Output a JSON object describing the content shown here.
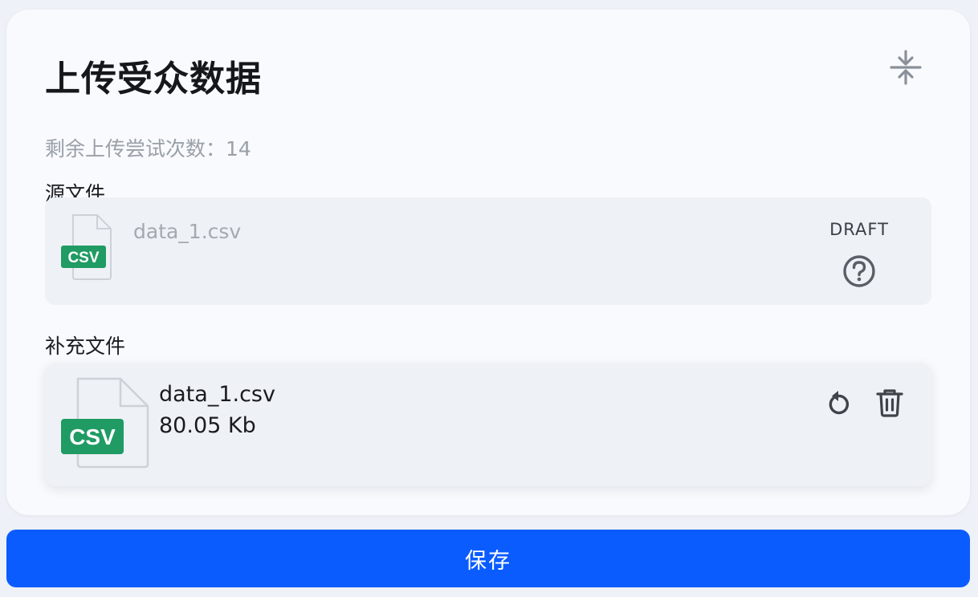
{
  "panel": {
    "title": "上传受众数据",
    "attempts_text": "剩余上传尝试次数：14",
    "collapse_icon": "collapse-vertical-icon"
  },
  "source_file": {
    "section_label": "源文件",
    "file_name": "data_1.csv",
    "badge": "CSV",
    "status": "DRAFT",
    "status_icon": "question-circle-icon"
  },
  "extra_file": {
    "section_label": "补充文件",
    "file_name": "data_1.csv",
    "file_size": "80.05 Kb",
    "badge": "CSV",
    "actions": [
      "replace-icon",
      "trash-icon"
    ]
  },
  "footer": {
    "save_label": "保存"
  },
  "colors": {
    "accent": "#0a5cff",
    "csv_badge": "#1f9b63",
    "card_bg": "#f8fafd"
  }
}
